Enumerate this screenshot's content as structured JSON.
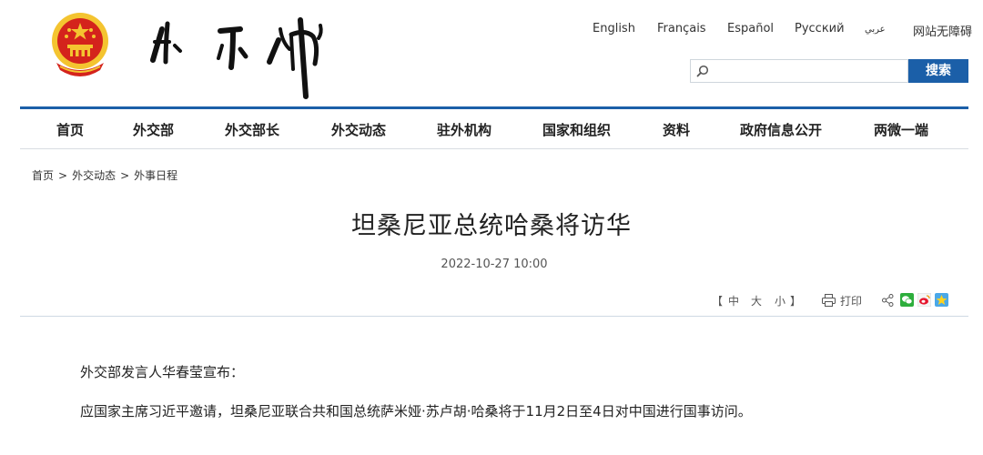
{
  "header": {
    "languages": [
      "English",
      "Français",
      "Español",
      "Русский",
      "عربي",
      "网站无障碍"
    ],
    "search": {
      "placeholder": "",
      "button_label": "搜索"
    }
  },
  "nav": {
    "items": [
      "首页",
      "外交部",
      "外交部长",
      "外交动态",
      "驻外机构",
      "国家和组织",
      "资料",
      "政府信息公开",
      "两微一端"
    ]
  },
  "breadcrumb": [
    "首页",
    "外交动态",
    "外事日程"
  ],
  "breadcrumb_separator": ">",
  "article": {
    "title": "坦桑尼亚总统哈桑将访华",
    "date": "2022-10-27 10:00",
    "paragraphs": [
      "外交部发言人华春莹宣布：",
      "应国家主席习近平邀请，坦桑尼亚联合共和国总统萨米娅·苏卢胡·哈桑将于11月2日至4日对中国进行国事访问。"
    ]
  },
  "tools": {
    "font_open": "【",
    "font_sizes": [
      "中",
      "大",
      "小"
    ],
    "font_close": "】",
    "print_label": "打印"
  },
  "colors": {
    "accent": "#1b5fa8",
    "emblem_red": "#d4231c",
    "emblem_gold": "#f4c430"
  }
}
